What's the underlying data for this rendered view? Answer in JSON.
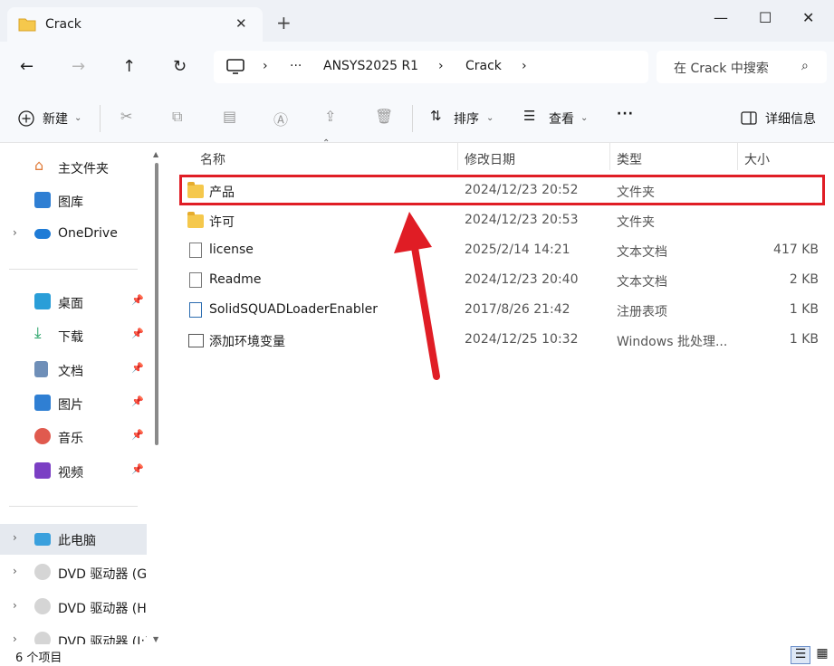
{
  "tab": {
    "title": "Crack",
    "close": "✕",
    "new_tab": "+"
  },
  "window": {
    "minimize": "—",
    "maximize": "☐",
    "close": "✕"
  },
  "nav": {
    "back": "←",
    "forward": "→",
    "up": "↑",
    "refresh": "↻"
  },
  "address": {
    "computer_icon": "monitor-icon",
    "segments": [
      "›",
      "···",
      "ANSYS2025 R1",
      "›",
      "Crack",
      "›"
    ]
  },
  "search": {
    "placeholder": "在 Crack 中搜索",
    "icon": "⌕"
  },
  "toolbar": {
    "new_label": "新建",
    "sort_label": "排序",
    "view_label": "查看",
    "more_label": "···",
    "details_label": "详细信息"
  },
  "sidebar": {
    "home": "主文件夹",
    "gallery": "图库",
    "onedrive": "OneDrive",
    "desktop": "桌面",
    "downloads": "下载",
    "documents": "文档",
    "pictures": "图片",
    "music": "音乐",
    "videos": "视频",
    "this_pc": "此电脑",
    "dvd_g": "DVD 驱动器 (G",
    "dvd_h": "DVD 驱动器 (H",
    "dvd_i": "DVD 驱动器 (I:)"
  },
  "columns": {
    "name": "名称",
    "modified": "修改日期",
    "type": "类型",
    "size": "大小"
  },
  "files": [
    {
      "name": "产品",
      "modified": "2024/12/23 20:52",
      "type": "文件夹",
      "size": ""
    },
    {
      "name": "许可",
      "modified": "2024/12/23 20:53",
      "type": "文件夹",
      "size": ""
    },
    {
      "name": "license",
      "modified": "2025/2/14 14:21",
      "type": "文本文档",
      "size": "417 KB"
    },
    {
      "name": "Readme",
      "modified": "2024/12/23 20:40",
      "type": "文本文档",
      "size": "2 KB"
    },
    {
      "name": "SolidSQUADLoaderEnabler",
      "modified": "2017/8/26 21:42",
      "type": "注册表项",
      "size": "1 KB"
    },
    {
      "name": "添加环境变量",
      "modified": "2024/12/25 10:32",
      "type": "Windows 批处理...",
      "size": "1 KB"
    }
  ],
  "status": {
    "count": "6 个项目"
  },
  "colors": {
    "highlight": "#e01d25",
    "folder": "#f5c84c",
    "accent": "#2b6cb0"
  }
}
